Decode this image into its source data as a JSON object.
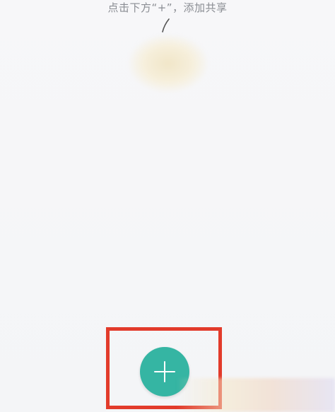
{
  "hint": {
    "text": "点击下方“+”，添加共享"
  },
  "colors": {
    "background": "#f6f7f9",
    "accent": "#35b5a3",
    "highlight": "#e23b2b",
    "hint_text": "#8a8d93"
  },
  "icons": {
    "add": "plus-icon",
    "pointer": "curved-arrow-icon"
  }
}
